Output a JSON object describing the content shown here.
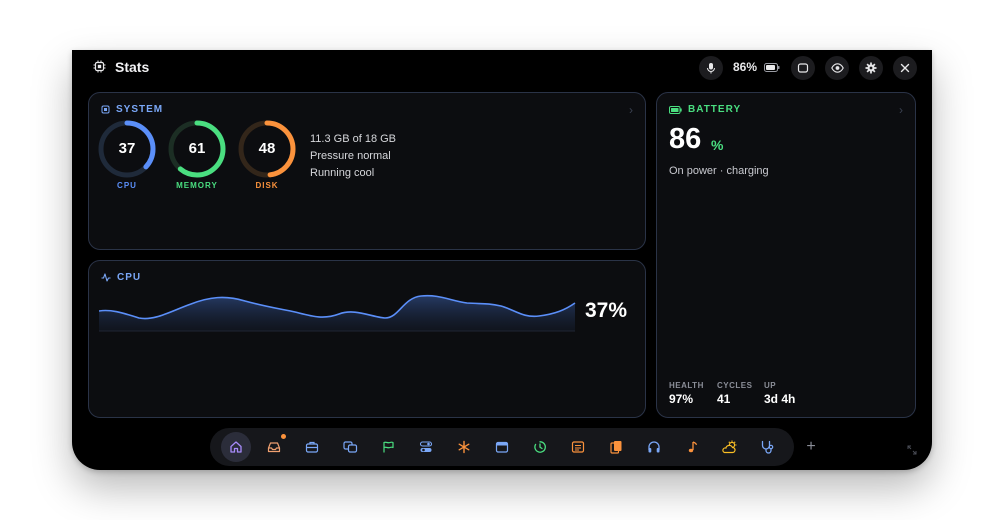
{
  "app": {
    "title": "Stats"
  },
  "titlebar": {
    "battery_percent": "86%"
  },
  "system": {
    "label": "SYSTEM",
    "gauges": [
      {
        "value": "37",
        "label": "CPU",
        "fraction": 0.37,
        "color": "#5b8ff9"
      },
      {
        "value": "61",
        "label": "MEMORY",
        "fraction": 0.61,
        "color": "#4ade80"
      },
      {
        "value": "48",
        "label": "DISK",
        "fraction": 0.48,
        "color": "#fb923c"
      }
    ],
    "info": [
      "11.3 GB of 18 GB",
      "Pressure normal",
      "Running cool"
    ]
  },
  "cpu": {
    "label": "CPU",
    "percent": "37%",
    "color": "#5b8ff9"
  },
  "battery": {
    "label": "BATTERY",
    "value": "86",
    "unit": "%",
    "status": "On power · charging",
    "stats": [
      {
        "label": "HEALTH",
        "value": "97%"
      },
      {
        "label": "CYCLES",
        "value": "41"
      },
      {
        "label": "UP",
        "value": "3d 4h"
      }
    ]
  },
  "dock": {
    "items": [
      {
        "icon": "home-icon",
        "color": "#a78bfa",
        "active": true
      },
      {
        "icon": "inbox-icon",
        "color": "#f0a070",
        "badge": true
      },
      {
        "icon": "briefcase-icon",
        "color": "#7aa7f7"
      },
      {
        "icon": "windows-icon",
        "color": "#7aa7f7"
      },
      {
        "icon": "flag-icon",
        "color": "#4ade80"
      },
      {
        "icon": "toggles-icon",
        "color": "#7aa7f7"
      },
      {
        "icon": "asterisk-icon",
        "color": "#fb923c"
      },
      {
        "icon": "calendar-icon",
        "color": "#7aa7f7"
      },
      {
        "icon": "timer-icon",
        "color": "#4ade80"
      },
      {
        "icon": "notes-icon",
        "color": "#fb923c"
      },
      {
        "icon": "clipboard-icon",
        "color": "#fb923c"
      },
      {
        "icon": "headphones-icon",
        "color": "#7aa7f7"
      },
      {
        "icon": "music-icon",
        "color": "#fb923c"
      },
      {
        "icon": "weather-icon",
        "color": "#fbbf24"
      },
      {
        "icon": "stethoscope-icon",
        "color": "#7aa7f7"
      }
    ],
    "add_label": "+"
  }
}
